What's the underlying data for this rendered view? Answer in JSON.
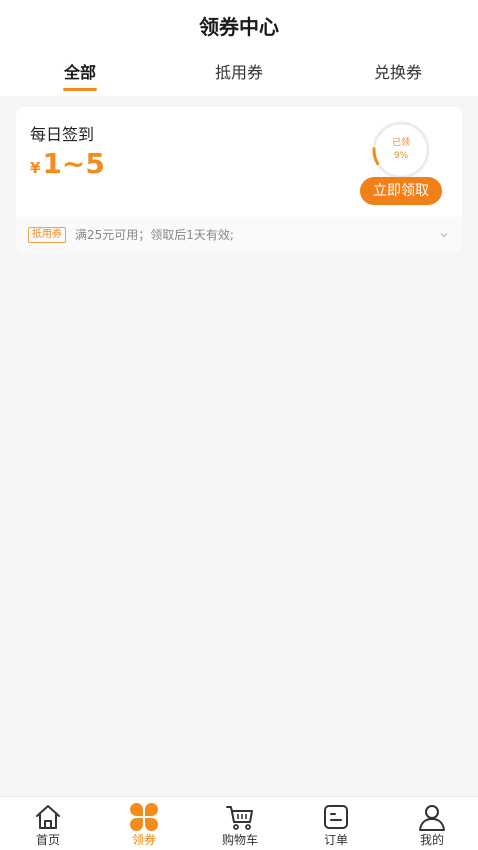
{
  "header": {
    "title": "领券中心",
    "tabs": [
      {
        "label": "全部",
        "active": true
      },
      {
        "label": "抵用券",
        "active": false
      },
      {
        "label": "兑换券",
        "active": false
      }
    ]
  },
  "coupons": [
    {
      "name": "每日签到",
      "currency": "¥",
      "amount": "1~5",
      "progress_label": "已领",
      "progress_text": "9%",
      "progress_fraction": 0.09,
      "claim_label": "立即领取",
      "type_badge": "抵用券",
      "description": "满25元可用；领取后1天有效;"
    }
  ],
  "bottom_nav": [
    {
      "label": "首页",
      "icon": "home-icon",
      "active": false
    },
    {
      "label": "领券",
      "icon": "coupon-clover-icon",
      "active": true
    },
    {
      "label": "购物车",
      "icon": "cart-icon",
      "active": false
    },
    {
      "label": "订单",
      "icon": "order-icon",
      "active": false
    },
    {
      "label": "我的",
      "icon": "profile-icon",
      "active": false
    }
  ],
  "colors": {
    "accent": "#f28c1c",
    "button": "#f28019",
    "background": "#f5f5f5"
  }
}
